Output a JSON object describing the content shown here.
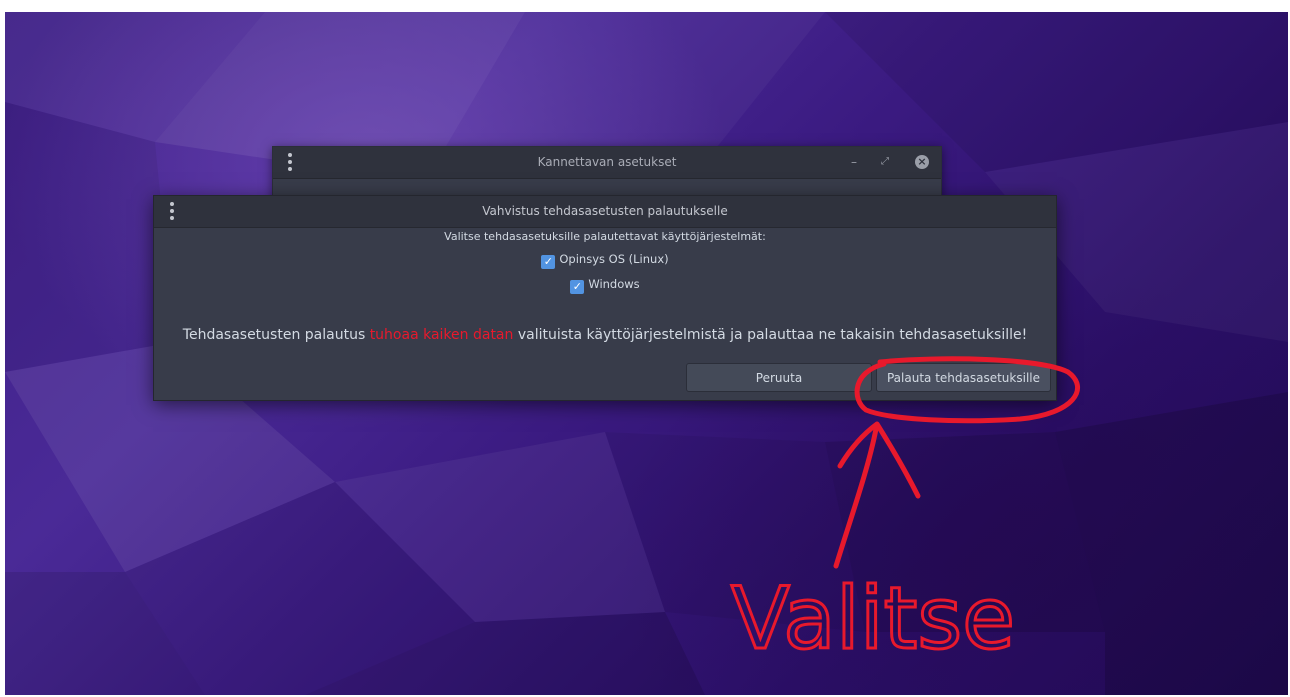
{
  "back_window": {
    "title": "Kannettavan asetukset",
    "minimize_glyph": "–",
    "maximize_glyph": "⤢",
    "close_glyph": "×"
  },
  "dialog": {
    "title": "Vahvistus tehdasasetusten palautukselle",
    "prompt": "Valitse tehdasasetuksille palautettavat käyttöjärjestelmät:",
    "options": [
      {
        "label": "Opinsys OS (Linux)",
        "checked": true
      },
      {
        "label": "Windows",
        "checked": true
      }
    ],
    "warning_before": "Tehdasasetusten palautus ",
    "warning_danger": "tuhoaa kaiken datan",
    "warning_after": " valituista käyttöjärjestelmistä ja palauttaa ne takaisin tehdasasetuksille!",
    "cancel_label": "Peruuta",
    "reset_label": "Palauta tehdasasetuksille"
  },
  "annotation": {
    "word": "Valitse",
    "color": "#e8192c"
  },
  "check_glyph": "✓"
}
